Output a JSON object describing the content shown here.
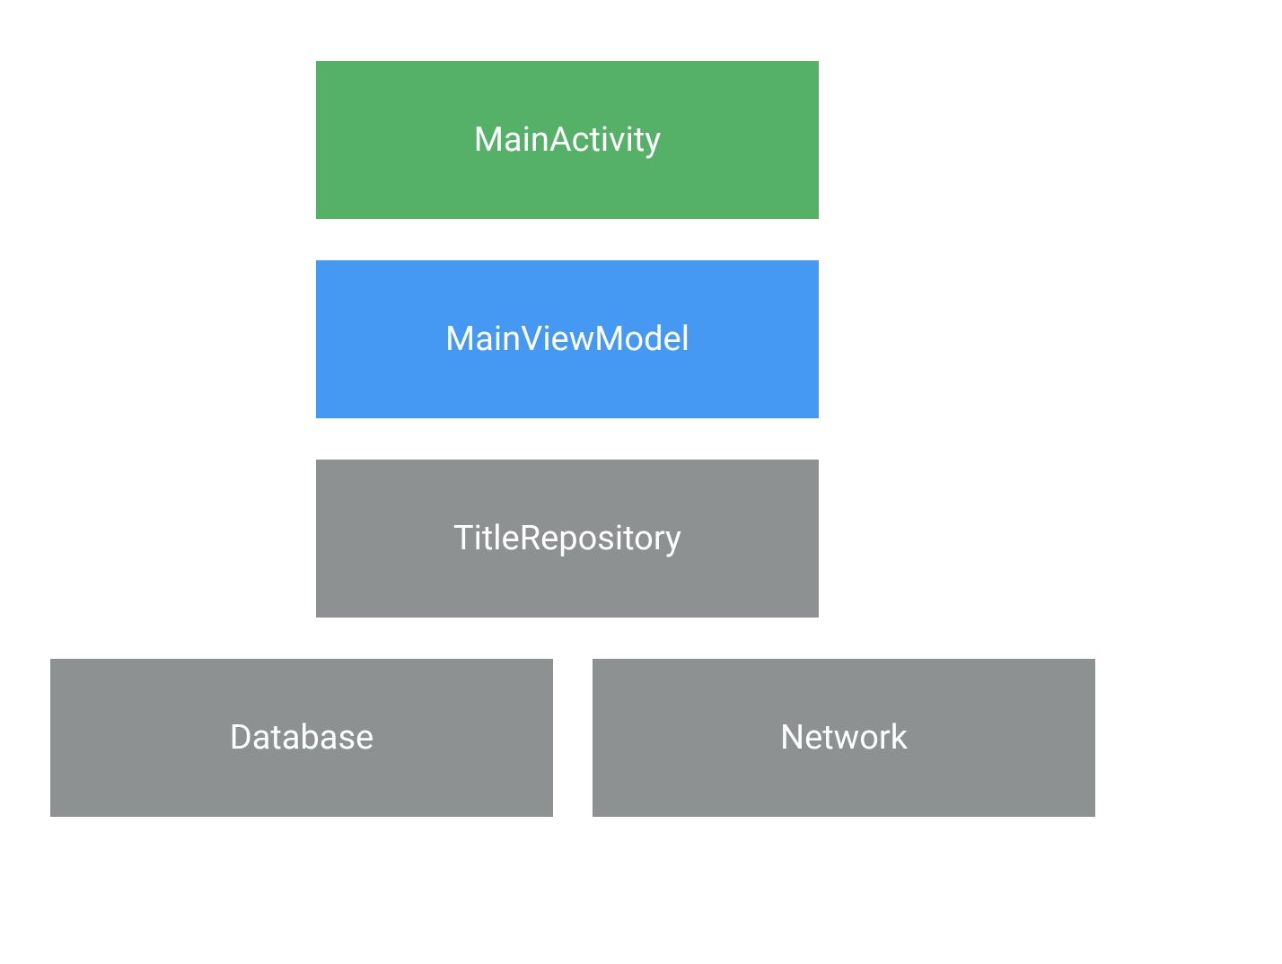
{
  "boxes": {
    "activity": {
      "label": "MainActivity",
      "color": "#55b068"
    },
    "viewmodel": {
      "label": "MainViewModel",
      "color": "#4699f3"
    },
    "repository": {
      "label": "TitleRepository",
      "color": "#8e9192"
    },
    "database": {
      "label": "Database",
      "color": "#8e9192"
    },
    "network": {
      "label": "Network",
      "color": "#8e9192"
    }
  }
}
